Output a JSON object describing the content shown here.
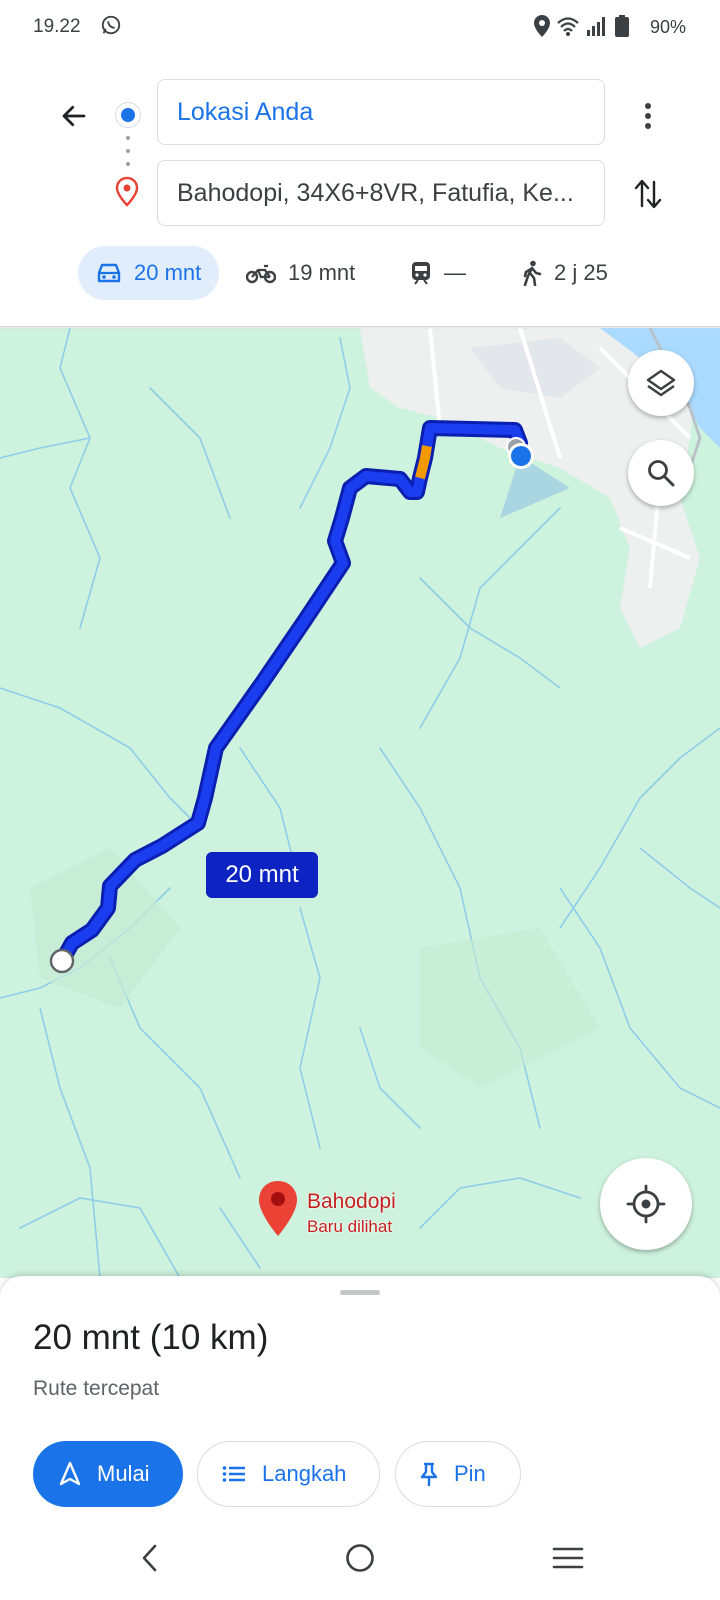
{
  "status_bar": {
    "time": "19.22",
    "battery": "90%",
    "icons": [
      "whatsapp-icon",
      "location-icon",
      "wifi-icon",
      "signal-icon",
      "battery-icon"
    ]
  },
  "directions": {
    "origin": "Lokasi Anda",
    "destination": "Bahodopi, 34X6+8VR, Fatufia, Ke...",
    "modes": [
      {
        "name": "car",
        "icon": "car-icon",
        "label": "20 mnt",
        "active": true
      },
      {
        "name": "motorcycle",
        "icon": "motorcycle-icon",
        "label": "19 mnt",
        "active": false
      },
      {
        "name": "transit",
        "icon": "train-icon",
        "label": "—",
        "active": false
      },
      {
        "name": "walk",
        "icon": "walk-icon",
        "label": "2 j 25",
        "active": false
      }
    ]
  },
  "map": {
    "route_label": "20 mnt",
    "place": {
      "name": "Bahodopi",
      "subtitle": "Baru dilihat"
    },
    "colors": {
      "land": "#cdf2dd",
      "route": "#1a3df0",
      "traffic": "#f29900",
      "water": "#aadaff"
    }
  },
  "sheet": {
    "summary": "20 mnt (10 km)",
    "subtitle": "Rute tercepat",
    "buttons": {
      "start": "Mulai",
      "steps": "Langkah",
      "pin": "Pin"
    }
  },
  "colors": {
    "accent": "#1a73e8",
    "pin": "#ea4335"
  }
}
